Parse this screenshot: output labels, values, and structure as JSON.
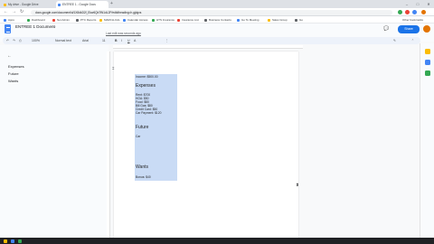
{
  "browser": {
    "tabs": [
      {
        "label": "My drive - Google Drive",
        "color": "#fbbc04"
      },
      {
        "label": "ENTREE 1 - Google Docs",
        "color": "#4285f4"
      }
    ],
    "new_tab": "+",
    "window_controls": {
      "minimize": "–",
      "maximize": "□",
      "close": "✕"
    },
    "nav": {
      "back": "←",
      "forward": "→",
      "reload": "↻"
    },
    "address": "docs.google.com/document/d/1X8dkD2f_Ekw6Qb7fN1dL2P/edit#heading=h.gjdgxs",
    "bookmarks": [
      {
        "label": "Apps",
        "color": "#4285f4"
      },
      {
        "label": "Dashboard",
        "color": "#34a853"
      },
      {
        "label": "Net Admin",
        "color": "#ea4335"
      },
      {
        "label": "PTC Reports",
        "color": "#5f6368"
      },
      {
        "label": "MARCH-CAL",
        "color": "#fbbc04"
      },
      {
        "label": "Calendar Access",
        "color": "#4285f4"
      },
      {
        "label": "HTS Insurance",
        "color": "#34a853"
      },
      {
        "label": "Insurance List",
        "color": "#ea4335"
      },
      {
        "label": "Business Contacts",
        "color": "#5f6368"
      },
      {
        "label": "Go To Meeting",
        "color": "#4285f4"
      },
      {
        "label": "Sales Group",
        "color": "#fbbc04"
      },
      {
        "label": "Go",
        "color": "#5f6368"
      }
    ],
    "other_bookmarks": "Other bookmarks"
  },
  "doc": {
    "title": "ENTREE 1 Document",
    "star": "☆",
    "menus": [
      "File",
      "Edit",
      "View",
      "Insert",
      "Format",
      "Tools",
      "Add-ons",
      "Help"
    ],
    "last_edit": "Last edit was seconds ago",
    "share_label": "Share",
    "comment_icon": "comment-icon"
  },
  "toolbar": {
    "undo": "↶",
    "redo": "↷",
    "print": "⎙",
    "zoom": "100%",
    "style": "Normal text",
    "font": "Arial",
    "size": "11",
    "bold": "B",
    "italic": "I",
    "underline": "U",
    "color": "A",
    "more": "⋮",
    "edit_mode": "✎",
    "collapse": "⌃"
  },
  "outline": {
    "back": "←",
    "items": [
      "Expenses",
      "Future",
      "Wants"
    ]
  },
  "document_content": {
    "income_line": "Income: $500.00",
    "heading_expenses": "Expenses",
    "expenses": [
      "Rent: $700",
      "HOA: $50",
      "Food: $80",
      "Bill Gas: $80",
      "Credit Card: $50",
      "Car Payment: $120"
    ],
    "heading_future": "Future",
    "future_line": "Car",
    "heading_wants": "Wants",
    "wants_line": "Bonus: $40"
  },
  "taskbar": {
    "items": [
      "Explorer",
      "Chrome",
      "Docs"
    ]
  }
}
